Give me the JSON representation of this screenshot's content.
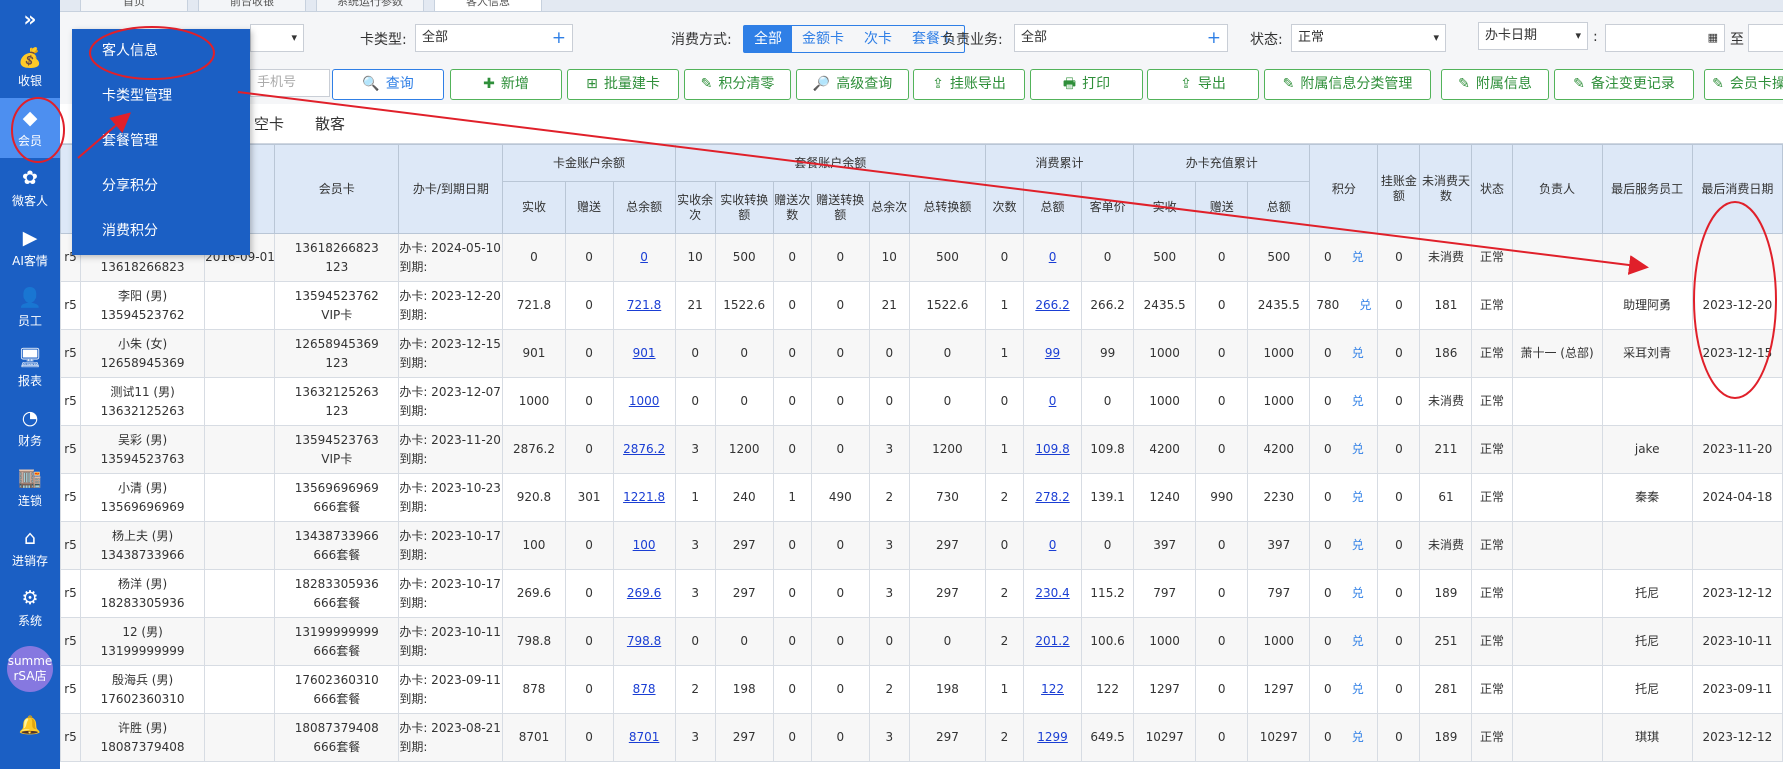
{
  "sidebar": {
    "collapse_icon": "»",
    "items": [
      {
        "label": "收银",
        "icon": "money-bag-icon",
        "glyph": "💰"
      },
      {
        "label": "会员",
        "icon": "diamond-icon",
        "glyph": "◆"
      },
      {
        "label": "微客人",
        "icon": "flower-icon",
        "glyph": "✿"
      },
      {
        "label": "AI客情",
        "icon": "play-icon",
        "glyph": "▶"
      },
      {
        "label": "员工",
        "icon": "person-icon",
        "glyph": "👤"
      },
      {
        "label": "报表",
        "icon": "monitor-icon",
        "glyph": "🖥"
      },
      {
        "label": "财务",
        "icon": "pie-chart-icon",
        "glyph": "◔"
      },
      {
        "label": "连锁",
        "icon": "store-icon",
        "glyph": "🏬"
      },
      {
        "label": "进销存",
        "icon": "house-icon",
        "glyph": "⌂"
      },
      {
        "label": "系统",
        "icon": "gear-icon",
        "glyph": "⚙"
      }
    ],
    "store_badge": "summe rSA店",
    "bell_glyph": "🔔"
  },
  "top_tabs": [
    "首页",
    "前台收银",
    "系统运行参数",
    "客人信息"
  ],
  "dropdown": [
    "客人信息",
    "卡类型管理",
    "套餐管理",
    "分享积分",
    "消费积分"
  ],
  "filters": {
    "card_type_label": "卡类型:",
    "card_type_value": "全部",
    "pay_method_label": "消费方式:",
    "pay_methods": [
      "全部",
      "金额卡",
      "次卡",
      "套餐卡"
    ],
    "owner_label": "负责业务:",
    "owner_value": "全部",
    "status_label": "状态:",
    "status_value": "正常",
    "date_type_value": "办卡日期",
    "date_sep": ":",
    "date_to": "至",
    "phone_placeholder": "手机号"
  },
  "buttons": [
    {
      "label": "查询",
      "glyph": "🔍"
    },
    {
      "label": "新增",
      "glyph": "✚"
    },
    {
      "label": "批量建卡",
      "glyph": "⊞"
    },
    {
      "label": "积分清零",
      "glyph": "✎"
    },
    {
      "label": "高级查询",
      "glyph": "🔎"
    },
    {
      "label": "挂账导出",
      "glyph": "⇪"
    },
    {
      "label": "打印",
      "glyph": "🖶"
    },
    {
      "label": "导出",
      "glyph": "⇪"
    },
    {
      "label": "附属信息分类管理",
      "glyph": "✎"
    },
    {
      "label": "附属信息",
      "glyph": "✎"
    },
    {
      "label": "备注变更记录",
      "glyph": "✎"
    },
    {
      "label": "会员卡操",
      "glyph": "✎"
    }
  ],
  "subtabs": [
    "空卡",
    "散客"
  ],
  "table": {
    "header_groups": {
      "member_card": "会员卡",
      "card_dates": "办卡/到期日期",
      "gold_balance": "卡金账户余额",
      "package_balance": "套餐账户余额",
      "consumption": "消费累计",
      "recharge": "办卡充值累计",
      "points": "积分",
      "on_account": "挂账金额",
      "days_no_consume": "未消费天数",
      "status": "状态",
      "owner": "负责人",
      "last_staff": "最后服务员工",
      "last_date": "最后消费日期"
    },
    "sub_headers": {
      "gold": [
        "实收",
        "赠送",
        "总余额"
      ],
      "package": [
        "实收余次",
        "实收转换额",
        "赠送次数",
        "赠送转换额",
        "总余次",
        "总转换额"
      ],
      "consumption": [
        "次数",
        "总额",
        "客单价"
      ],
      "recharge": [
        "实收",
        "赠送",
        "总额"
      ]
    },
    "rows": [
      {
        "c0": "r5",
        "name": "",
        "phone": "13618266823",
        "reg": "2016-09-01",
        "card": "13618266823",
        "card_type": "123",
        "open": "办卡: 2024-05-10",
        "expire": "到期:",
        "g1": "0",
        "g2": "0",
        "g3": "0",
        "p1": "10",
        "p2": "500",
        "p3": "0",
        "p4": "0",
        "p5": "10",
        "p6": "500",
        "c1": "0",
        "c2": "0",
        "c3": "0",
        "r1": "500",
        "r2": "0",
        "r3": "500",
        "pts": "0",
        "ex": "兑",
        "acct": "0",
        "days": "未消费",
        "status": "正常",
        "owner": "",
        "staff": "",
        "last": ""
      },
      {
        "c0": "r5",
        "name": "李阳 (男)",
        "phone": "13594523762",
        "reg": "",
        "card": "13594523762",
        "card_type": "VIP卡",
        "open": "办卡: 2023-12-20",
        "expire": "到期:",
        "g1": "721.8",
        "g2": "0",
        "g3": "721.8",
        "p1": "21",
        "p2": "1522.6",
        "p3": "0",
        "p4": "0",
        "p5": "21",
        "p6": "1522.6",
        "c1": "1",
        "c2": "266.2",
        "c3": "266.2",
        "r1": "2435.5",
        "r2": "0",
        "r3": "2435.5",
        "pts": "780",
        "ex": "兑",
        "acct": "0",
        "days": "181",
        "status": "正常",
        "owner": "",
        "staff": "助理阿勇",
        "last": "2023-12-20"
      },
      {
        "c0": "r5",
        "name": "小朱 (女)",
        "phone": "12658945369",
        "reg": "",
        "card": "12658945369",
        "card_type": "123",
        "open": "办卡: 2023-12-15",
        "expire": "到期:",
        "g1": "901",
        "g2": "0",
        "g3": "901",
        "p1": "0",
        "p2": "0",
        "p3": "0",
        "p4": "0",
        "p5": "0",
        "p6": "0",
        "c1": "1",
        "c2": "99",
        "c3": "99",
        "r1": "1000",
        "r2": "0",
        "r3": "1000",
        "pts": "0",
        "ex": "兑",
        "acct": "0",
        "days": "186",
        "status": "正常",
        "owner": "萧十一 (总部)",
        "staff": "采耳刘青",
        "last": "2023-12-15"
      },
      {
        "c0": "r5",
        "name": "测试11 (男)",
        "phone": "13632125263",
        "reg": "",
        "card": "13632125263",
        "card_type": "123",
        "open": "办卡: 2023-12-07",
        "expire": "到期:",
        "g1": "1000",
        "g2": "0",
        "g3": "1000",
        "p1": "0",
        "p2": "0",
        "p3": "0",
        "p4": "0",
        "p5": "0",
        "p6": "0",
        "c1": "0",
        "c2": "0",
        "c3": "0",
        "r1": "1000",
        "r2": "0",
        "r3": "1000",
        "pts": "0",
        "ex": "兑",
        "acct": "0",
        "days": "未消费",
        "status": "正常",
        "owner": "",
        "staff": "",
        "last": ""
      },
      {
        "c0": "r5",
        "name": "吴彩 (男)",
        "phone": "13594523763",
        "reg": "",
        "card": "13594523763",
        "card_type": "VIP卡",
        "open": "办卡: 2023-11-20",
        "expire": "到期:",
        "g1": "2876.2",
        "g2": "0",
        "g3": "2876.2",
        "p1": "3",
        "p2": "1200",
        "p3": "0",
        "p4": "0",
        "p5": "3",
        "p6": "1200",
        "c1": "1",
        "c2": "109.8",
        "c3": "109.8",
        "r1": "4200",
        "r2": "0",
        "r3": "4200",
        "pts": "0",
        "ex": "兑",
        "acct": "0",
        "days": "211",
        "status": "正常",
        "owner": "",
        "staff": "jake",
        "last": "2023-11-20"
      },
      {
        "c0": "r5",
        "name": "小清 (男)",
        "phone": "13569696969",
        "reg": "",
        "card": "13569696969",
        "card_type": "666套餐",
        "open": "办卡: 2023-10-23",
        "expire": "到期:",
        "g1": "920.8",
        "g2": "301",
        "g3": "1221.8",
        "p1": "1",
        "p2": "240",
        "p3": "1",
        "p4": "490",
        "p5": "2",
        "p6": "730",
        "c1": "2",
        "c2": "278.2",
        "c3": "139.1",
        "r1": "1240",
        "r2": "990",
        "r3": "2230",
        "pts": "0",
        "ex": "兑",
        "acct": "0",
        "days": "61",
        "status": "正常",
        "owner": "",
        "staff": "秦秦",
        "last": "2024-04-18"
      },
      {
        "c0": "r5",
        "name": "杨上夫 (男)",
        "phone": "13438733966",
        "reg": "",
        "card": "13438733966",
        "card_type": "666套餐",
        "open": "办卡: 2023-10-17",
        "expire": "到期:",
        "g1": "100",
        "g2": "0",
        "g3": "100",
        "p1": "3",
        "p2": "297",
        "p3": "0",
        "p4": "0",
        "p5": "3",
        "p6": "297",
        "c1": "0",
        "c2": "0",
        "c3": "0",
        "r1": "397",
        "r2": "0",
        "r3": "397",
        "pts": "0",
        "ex": "兑",
        "acct": "0",
        "days": "未消费",
        "status": "正常",
        "owner": "",
        "staff": "",
        "last": ""
      },
      {
        "c0": "r5",
        "name": "杨洋 (男)",
        "phone": "18283305936",
        "reg": "",
        "card": "18283305936",
        "card_type": "666套餐",
        "open": "办卡: 2023-10-17",
        "expire": "到期:",
        "g1": "269.6",
        "g2": "0",
        "g3": "269.6",
        "p1": "3",
        "p2": "297",
        "p3": "0",
        "p4": "0",
        "p5": "3",
        "p6": "297",
        "c1": "2",
        "c2": "230.4",
        "c3": "115.2",
        "r1": "797",
        "r2": "0",
        "r3": "797",
        "pts": "0",
        "ex": "兑",
        "acct": "0",
        "days": "189",
        "status": "正常",
        "owner": "",
        "staff": "托尼",
        "last": "2023-12-12"
      },
      {
        "c0": "r5",
        "name": "12 (男)",
        "phone": "13199999999",
        "reg": "",
        "card": "13199999999",
        "card_type": "666套餐",
        "open": "办卡: 2023-10-11",
        "expire": "到期:",
        "g1": "798.8",
        "g2": "0",
        "g3": "798.8",
        "p1": "0",
        "p2": "0",
        "p3": "0",
        "p4": "0",
        "p5": "0",
        "p6": "0",
        "c1": "2",
        "c2": "201.2",
        "c3": "100.6",
        "r1": "1000",
        "r2": "0",
        "r3": "1000",
        "pts": "0",
        "ex": "兑",
        "acct": "0",
        "days": "251",
        "status": "正常",
        "owner": "",
        "staff": "托尼",
        "last": "2023-10-11"
      },
      {
        "c0": "r5",
        "name": "殷海兵 (男)",
        "phone": "17602360310",
        "reg": "",
        "card": "17602360310",
        "card_type": "666套餐",
        "open": "办卡: 2023-09-11",
        "expire": "到期:",
        "g1": "878",
        "g2": "0",
        "g3": "878",
        "p1": "2",
        "p2": "198",
        "p3": "0",
        "p4": "0",
        "p5": "2",
        "p6": "198",
        "c1": "1",
        "c2": "122",
        "c3": "122",
        "r1": "1297",
        "r2": "0",
        "r3": "1297",
        "pts": "0",
        "ex": "兑",
        "acct": "0",
        "days": "281",
        "status": "正常",
        "owner": "",
        "staff": "托尼",
        "last": "2023-09-11"
      },
      {
        "c0": "r5",
        "name": "许胜 (男)",
        "phone": "18087379408",
        "reg": "",
        "card": "18087379408",
        "card_type": "666套餐",
        "open": "办卡: 2023-08-21",
        "expire": "到期:",
        "g1": "8701",
        "g2": "0",
        "g3": "8701",
        "p1": "3",
        "p2": "297",
        "p3": "0",
        "p4": "0",
        "p5": "3",
        "p6": "297",
        "c1": "2",
        "c2": "1299",
        "c3": "649.5",
        "r1": "10297",
        "r2": "0",
        "r3": "10297",
        "pts": "0",
        "ex": "兑",
        "acct": "0",
        "days": "189",
        "status": "正常",
        "owner": "",
        "staff": "琪琪",
        "last": "2023-12-12"
      }
    ]
  },
  "colors": {
    "sidebar": "#1b5fc4",
    "accent": "#2f7fe6",
    "button_green": "#52b35a",
    "annotation_red": "#e0202a",
    "header_bg": "#dde8f7"
  }
}
